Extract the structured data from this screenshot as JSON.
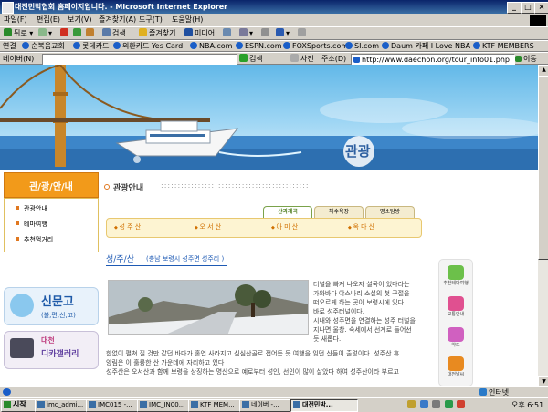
{
  "window": {
    "title": "대전민박협회 홈페이지입니다. - Microsoft Internet Explorer"
  },
  "menu": [
    "파일(F)",
    "편집(E)",
    "보기(V)",
    "즐겨찾기(A)",
    "도구(T)",
    "도움말(H)"
  ],
  "toolbar": {
    "back": "뒤로",
    "search": "검색",
    "favorites": "즐겨찾기",
    "media": "미디어"
  },
  "links": {
    "label": "연결",
    "items": [
      "순복음교회",
      "롯데카드",
      "외환카드 Yes Card",
      "NBA.com",
      "ESPN.com",
      "FOXSports.com",
      "SI.com",
      "Daum 카페 I Love NBA",
      "KTF MEMBERS"
    ]
  },
  "naver": {
    "label": "네이버(N)",
    "search": "검색",
    "dict": "사전"
  },
  "address": {
    "label": "주소(D)",
    "url": "http://www.daechon.org/tour_info01.php",
    "go": "이동"
  },
  "banner": {
    "logo_text": "관광"
  },
  "sidebar": {
    "title": "관/광/안/내",
    "items": [
      "관광안내",
      "테마여행",
      "추천먹거리"
    ],
    "ad1": {
      "title": "신문고",
      "sub": "(불,편,신,고)"
    },
    "ad2": {
      "title": "대천",
      "sub": "디카갤러리"
    }
  },
  "section": {
    "title": "관광안내",
    "dots": "::::::::::::::::::::::::::::::::::::::::::::"
  },
  "tabs": [
    "산과계곡",
    "해수욕장",
    "명소탐방"
  ],
  "mountains": [
    "성 주 산",
    "오 서 산",
    "아 미 산",
    "옥 마 산"
  ],
  "place": {
    "name": "성/주/산",
    "location": "(충남 보령시 성주면 성주리 )"
  },
  "description": {
    "side": [
      "터널을 빠져 나오자 설국이 었다라는",
      "가와바다 야스나리 소설의 첫 구절을",
      "떠오르게 하는 곳이 보령시에 있다.",
      "바로 성주터널이다.",
      "시내와 성주면을 연결하는 성주 터널을",
      "지나면 울창. 숙세에서 선계로 들어선",
      "듯 새롭다."
    ],
    "full": [
      "한없이 펼쳐 질 것만 같던 바다가 홀연 사라지고 심심산골로 접어든 듯 여행을 잊던 산들이 출렁이다. 성주산 휴",
      "양림은 이 훌륭한 산 가운데에 자리하고 있다",
      "성주산은 오서산과 함께 보령을 상징하는 명산으로 예로부터 성인, 선인이 많이 살았다 하여 성주산이라 부르고"
    ]
  },
  "right_icons": [
    "추천테마여행",
    "교통안내",
    "약도",
    "대전날씨"
  ],
  "taskbar": {
    "start": "시작",
    "tasks": [
      "imc_admi...",
      "IMC015 -...",
      "IMC_IN00...",
      "KTF MEM...",
      "네이버 -...",
      "대전민박..."
    ],
    "tray_text": "인터넷",
    "clock": "오후 6:51"
  }
}
